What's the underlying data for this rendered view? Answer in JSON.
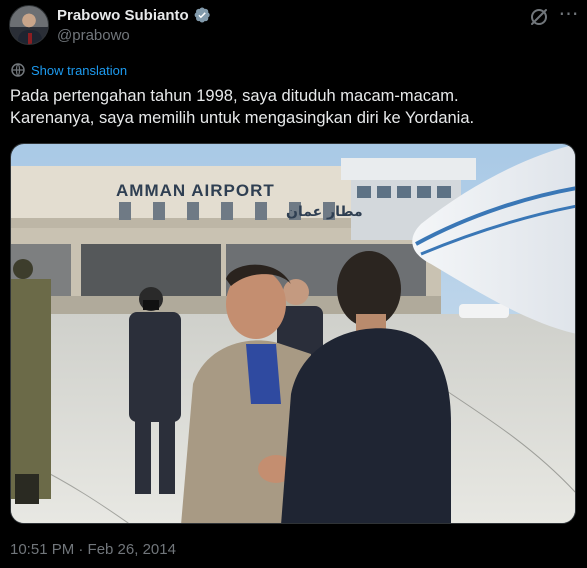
{
  "author": {
    "name": "Prabowo Subianto",
    "handle": "@prabowo",
    "verified": true
  },
  "icons": {
    "avatar": "avatar-photo",
    "verified": "verified-badge-icon",
    "grok": "grok-icon",
    "more": "more-icon",
    "translate": "globe-icon"
  },
  "actions": {
    "show_translation": "Show translation"
  },
  "tweet": {
    "line1": "Pada pertengahan tahun 1998, saya dituduh macam-macam.",
    "line2": "Karenanya, saya memilih untuk mengasingkan diri ke Yordania."
  },
  "media": {
    "sign_latin": "AMMAN AIRPORT",
    "sign_arabic": "مطار عمان"
  },
  "meta": {
    "timestamp": "10:51 PM · Feb 26, 2014"
  },
  "colors": {
    "background": "#000000",
    "text_primary": "#e7e9ea",
    "text_secondary": "#71767b",
    "link_blue": "#1d9bf0"
  }
}
